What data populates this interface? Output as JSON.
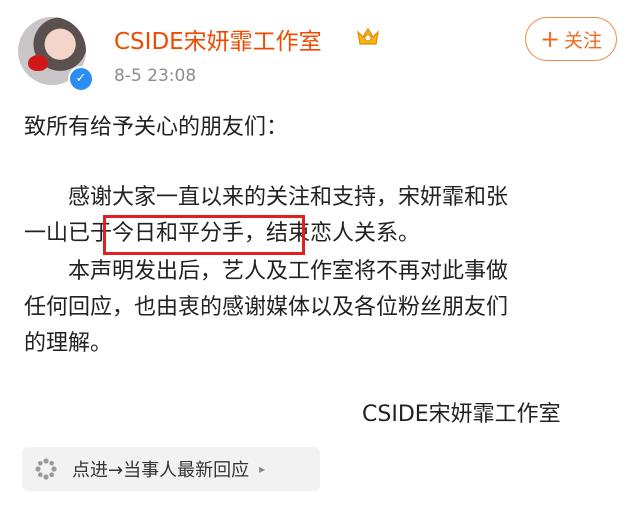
{
  "post": {
    "author_name": "CSIDE宋妍霏工作室",
    "timestamp": "8-5 23:08",
    "follow_label": "关注",
    "follow_plus": "+",
    "greeting": "致所有给予关心的朋友们：",
    "para1_line1": "感谢大家一直以来的关注和支持，宋妍霏和张",
    "para1_line2_pre": "一山已",
    "para1_line2_highlight": "于今日和平分手，",
    "para1_line2_post": "结束恋人关系。",
    "para2_line1": "本声明发出后，艺人及工作室将不再对此事做",
    "para2_line2": "任何回应，也由衷的感谢媒体以及各位粉丝朋友们",
    "para2_line3": "的理解。",
    "signature": "CSIDE宋妍霏工作室",
    "topic_tag": "点进→当事人最新回应",
    "topic_arrow": "▸"
  },
  "icons": {
    "verified": "verified-badge-icon",
    "crown": "vip-crown-icon",
    "topic": "flower-bloom-icon"
  },
  "colors": {
    "author": "#f04a00",
    "follow": "#f06a1f",
    "highlight_box": "#e02020",
    "verified": "#2b8ef3"
  }
}
